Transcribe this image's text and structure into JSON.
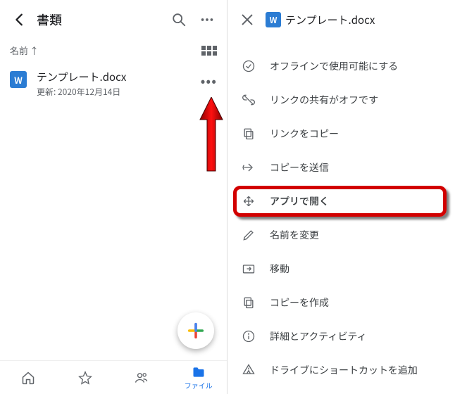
{
  "left": {
    "title": "書類",
    "sort": {
      "label": "名前",
      "direction": "↑"
    },
    "file": {
      "name": "テンプレート.docx",
      "subtitle": "更新: 2020年12月14日",
      "badge": "W"
    },
    "nav": {
      "files_label": "ファイル"
    }
  },
  "right": {
    "title": "テンプレート.docx",
    "badge": "W",
    "menu": {
      "offline": "オフラインで使用可能にする",
      "link_off": "リンクの共有がオフです",
      "copy_link": "リンクをコピー",
      "send_copy": "コピーを送信",
      "open_with": "アプリで開く",
      "rename": "名前を変更",
      "move": "移動",
      "make_copy": "コピーを作成",
      "details": "詳細とアクティビティ",
      "shortcut": "ドライブにショートカットを追加"
    }
  }
}
